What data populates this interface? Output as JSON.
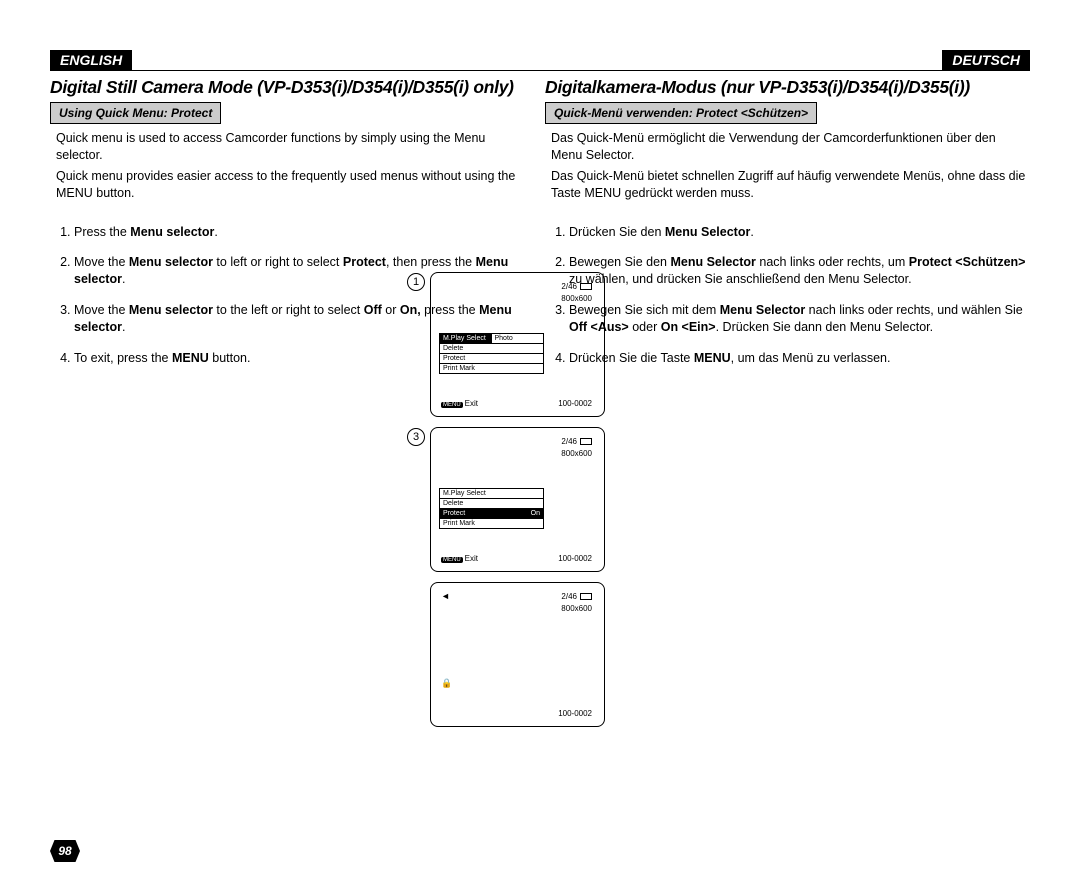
{
  "page_number": "98",
  "lang_left": "ENGLISH",
  "lang_right": "DEUTSCH",
  "title_left": "Digital Still Camera Mode (VP-D353(i)/D354(i)/D355(i) only)",
  "title_right": "Digitalkamera-Modus (nur VP-D353(i)/D354(i)/D355(i))",
  "subtitle_left": "Using Quick Menu: Protect",
  "subtitle_right": "Quick-Menü verwenden: Protect <Schützen>",
  "intro_left_1": "Quick menu is used to access Camcorder functions by simply using the Menu selector.",
  "intro_left_2": "Quick menu provides easier access to the frequently used menus without using the MENU button.",
  "intro_right_1": "Das Quick-Menü ermöglicht die Verwendung der Camcorderfunktionen über den Menu Selector.",
  "intro_right_2": "Das Quick-Menü bietet schnellen Zugriff auf häufig verwendete Menüs, ohne dass die Taste MENU gedrückt werden muss.",
  "steps_left": {
    "s1_a": "Press the ",
    "s1_b": "Menu selector",
    "s1_c": ".",
    "s2_a": "Move the ",
    "s2_b": "Menu selector",
    "s2_c": " to left or right to select ",
    "s2_d": "Protect",
    "s2_e": ", then press the ",
    "s2_f": "Menu selector",
    "s2_g": ".",
    "s3_a": "Move the ",
    "s3_b": "Menu selector",
    "s3_c": " to the left or right to select ",
    "s3_d": "Off",
    "s3_e": " or ",
    "s3_f": "On,",
    "s3_g": " press the ",
    "s3_h": "Menu selector",
    "s3_i": ".",
    "s4_a": "To exit, press the ",
    "s4_b": "MENU",
    "s4_c": " button."
  },
  "steps_right": {
    "s1_a": "Drücken Sie den ",
    "s1_b": "Menu Selector",
    "s1_c": ".",
    "s2_a": "Bewegen Sie den ",
    "s2_b": "Menu Selector",
    "s2_c": " nach links oder rechts, um ",
    "s2_d": "Protect <Schützen>",
    "s2_e": " zu wählen, und drücken Sie anschließend den Menu Selector.",
    "s3_a": "Bewegen Sie sich mit dem ",
    "s3_b": "Menu Selector",
    "s3_c": " nach links oder rechts, und wählen Sie ",
    "s3_d": "Off <Aus>",
    "s3_e": " oder ",
    "s3_f": "On <Ein>",
    "s3_g": ". Drücken Sie dann den Menu Selector.",
    "s4_a": "Drücken Sie die Taste ",
    "s4_b": "MENU",
    "s4_c": ", um das Menü zu verlassen."
  },
  "screens": {
    "counter": "2/46",
    "resolution": "800x600",
    "folder": "100-0002",
    "exit": "Exit",
    "menu_badge": "MENU",
    "menu1": {
      "r1_left": "M.Play Select",
      "r1_right": "Photo",
      "r2": "Delete",
      "r3": "Protect",
      "r4": "Print Mark"
    },
    "menu3": {
      "r1": "M.Play Select",
      "r2": "Delete",
      "r3_left": "Protect",
      "r3_right": "On",
      "r4": "Print Mark"
    }
  },
  "step_labels": {
    "one": "1",
    "three": "3"
  }
}
